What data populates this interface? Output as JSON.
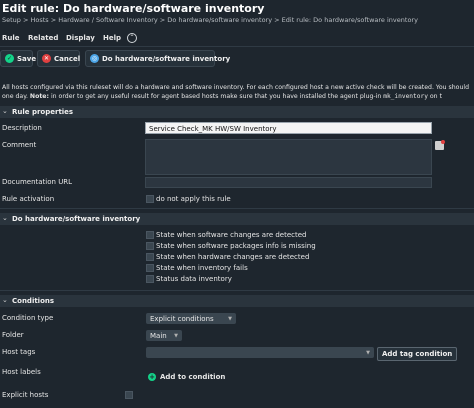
{
  "page": {
    "title": "Edit rule: Do hardware/software inventory",
    "breadcrumb": "Setup > Hosts > Hardware / Software Inventory > Do hardware/software inventory > Edit rule: Do hardware/software inventory"
  },
  "menu": {
    "items": [
      {
        "label": "Rule"
      },
      {
        "label": "Related"
      },
      {
        "label": "Display"
      },
      {
        "label": "Help"
      }
    ],
    "collapse_icon": "chevron-up"
  },
  "toolbar": {
    "save_label": "Save",
    "cancel_label": "Cancel",
    "run_label": "Do hardware/software inventory"
  },
  "info": {
    "line1": "All hosts configured via this ruleset will do a hardware and software inventory. For each configured host a new active check will be created. You should",
    "line2_pre": "one day.",
    "line2_bold": "Note:",
    "line2_mid": "in order to get any useful result for agent based hosts make sure that you have installed the agent plug-in",
    "line2_code": "mk_inventory",
    "line2_post": "on t"
  },
  "rule_properties": {
    "heading": "Rule properties",
    "description_label": "Description",
    "description_value": "Service Check_MK HW/SW Inventory",
    "comment_label": "Comment",
    "doc_url_label": "Documentation URL",
    "activation_label": "Rule activation",
    "activation_checkbox_label": "do not apply this rule"
  },
  "inventory": {
    "heading": "Do hardware/software inventory",
    "options": [
      {
        "label": "State when software changes are detected",
        "checked": false
      },
      {
        "label": "State when software packages info is missing",
        "checked": false
      },
      {
        "label": "State when hardware changes are detected",
        "checked": false
      },
      {
        "label": "State when inventory fails",
        "checked": false
      },
      {
        "label": "Status data inventory",
        "checked": false
      }
    ]
  },
  "conditions": {
    "heading": "Conditions",
    "condition_type_label": "Condition type",
    "condition_type_value": "Explicit conditions",
    "folder_label": "Folder",
    "folder_value": "Main",
    "host_tags_label": "Host tags",
    "add_tag_label": "Add tag condition",
    "host_labels_label": "Host labels",
    "add_condition_label": "Add to condition",
    "explicit_hosts_label": "Explicit hosts"
  },
  "colors": {
    "background": "#1e262e",
    "accent_green": "#13d389",
    "section_bg": "#2a343d",
    "cancel_red": "#e04040",
    "info_blue": "#4da6e8"
  }
}
